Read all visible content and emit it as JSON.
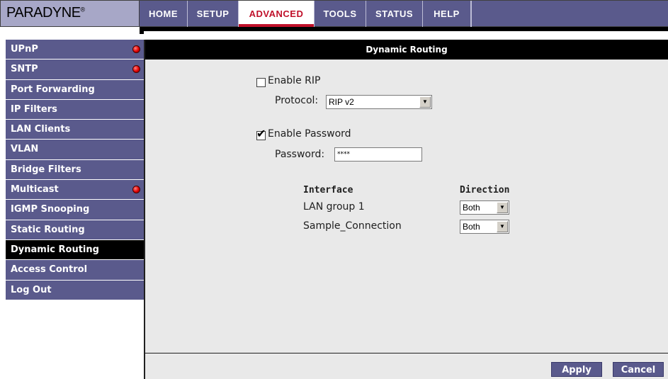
{
  "brand": {
    "logo_text": "PARADYNE",
    "logo_mark": "®"
  },
  "nav": {
    "tabs": [
      {
        "label": "HOME"
      },
      {
        "label": "SETUP"
      },
      {
        "label": "ADVANCED"
      },
      {
        "label": "TOOLS"
      },
      {
        "label": "STATUS"
      },
      {
        "label": "HELP"
      }
    ],
    "active": "ADVANCED"
  },
  "sidebar": {
    "items": [
      {
        "label": "UPnP",
        "alert": true
      },
      {
        "label": "SNTP",
        "alert": true
      },
      {
        "label": "Port Forwarding",
        "alert": false
      },
      {
        "label": "IP Filters",
        "alert": false
      },
      {
        "label": "LAN Clients",
        "alert": false
      },
      {
        "label": "VLAN",
        "alert": false
      },
      {
        "label": "Bridge Filters",
        "alert": false
      },
      {
        "label": "Multicast",
        "alert": true
      },
      {
        "label": "IGMP Snooping",
        "alert": false
      },
      {
        "label": "Static Routing",
        "alert": false
      },
      {
        "label": "Dynamic Routing",
        "alert": false
      },
      {
        "label": "Access Control",
        "alert": false
      },
      {
        "label": "Log Out",
        "alert": false
      }
    ],
    "active": "Dynamic Routing"
  },
  "main": {
    "section_title": "Dynamic Routing",
    "enable_rip": {
      "label": "Enable RIP",
      "checked": false
    },
    "protocol": {
      "label": "Protocol:",
      "value": "RIP v2"
    },
    "enable_password": {
      "label": "Enable Password",
      "checked": true
    },
    "password": {
      "label": "Password:",
      "value": "****"
    },
    "table": {
      "headers": {
        "interface": "Interface",
        "direction": "Direction"
      },
      "rows": [
        {
          "interface": "LAN group 1",
          "direction": "Both"
        },
        {
          "interface": "Sample_Connection",
          "direction": "Both"
        }
      ]
    }
  },
  "footer": {
    "apply_label": "Apply",
    "cancel_label": "Cancel"
  },
  "colors": {
    "nav_bg": "#5a5a8c",
    "accent_red": "#c0102a",
    "panel_bg": "#e9e9e9",
    "alert_dot": "#e00000"
  }
}
